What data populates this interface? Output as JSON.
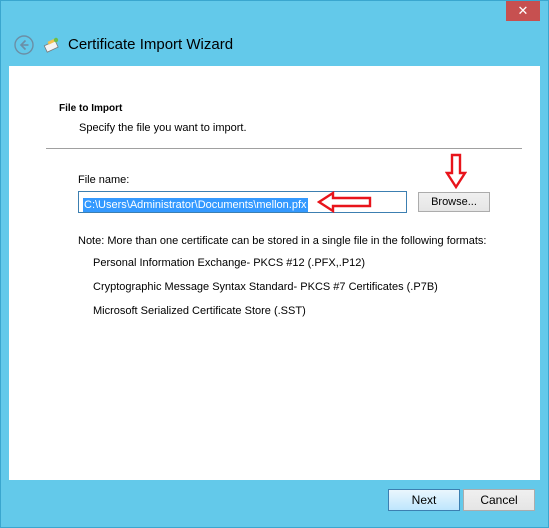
{
  "window": {
    "title": "Certificate Import Wizard",
    "close_symbol": "✕"
  },
  "page": {
    "heading": "File to Import",
    "subheading": "Specify the file you want to import."
  },
  "file": {
    "label": "File name:",
    "value": "C:\\Users\\Administrator\\Documents\\mellon.pfx",
    "browse_label": "Browse..."
  },
  "note": {
    "text": "Note:  More than one certificate can be stored in a single file in the following formats:",
    "formats": [
      "Personal Information Exchange- PKCS #12 (.PFX,.P12)",
      "Cryptographic Message Syntax Standard- PKCS #7 Certificates (.P7B)",
      "Microsoft Serialized Certificate Store (.SST)"
    ]
  },
  "footer": {
    "next_label": "Next",
    "cancel_label": "Cancel"
  },
  "colors": {
    "titlebar": "#63c9ea",
    "selection": "#3399ff",
    "annotation_arrow": "#e8141b"
  },
  "icons": {
    "back": "back-arrow-icon",
    "wizard": "certificate-wizard-icon",
    "annotation_left": "red-arrow-left-icon",
    "annotation_down": "red-arrow-down-icon"
  }
}
